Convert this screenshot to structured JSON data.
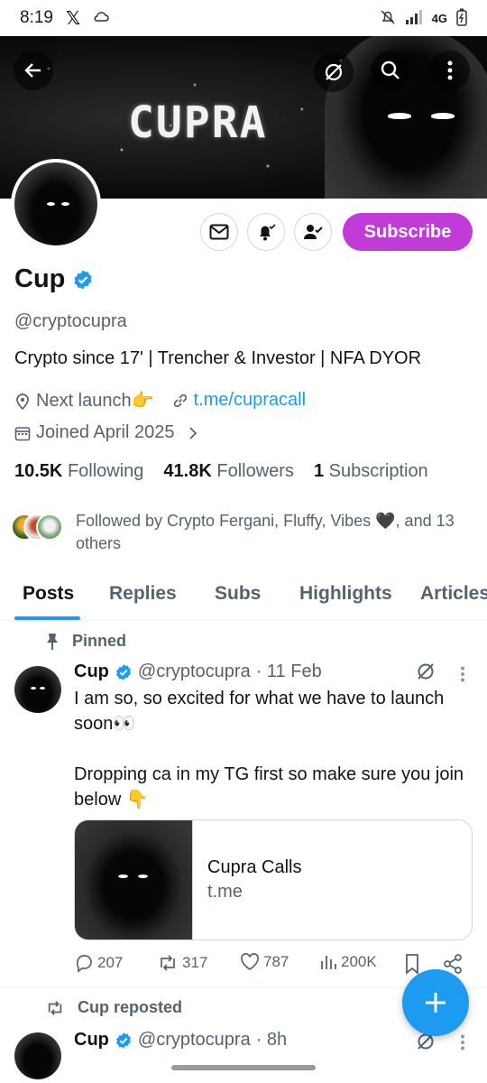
{
  "status_bar": {
    "time": "8:19",
    "network": "4G"
  },
  "banner": {
    "title": "CUPRA"
  },
  "profile": {
    "name": "Cup",
    "handle": "@cryptocupra",
    "bio": "Crypto since 17' | Trencher & Investor | NFA DYOR",
    "location": "Next launch👉",
    "link": "t.me/cupracall",
    "joined": "Joined April 2025",
    "subscribe_label": "Subscribe",
    "stats": {
      "following_count": "10.5K",
      "following_label": "Following",
      "followers_count": "41.8K",
      "followers_label": "Followers",
      "subscriptions_count": "1",
      "subscriptions_label": "Subscription"
    },
    "followed_by": "Followed by Crypto Fergani, Fluffy, Vibes 🖤, and 13 others"
  },
  "tabs": [
    "Posts",
    "Replies",
    "Subs",
    "Highlights",
    "Articles"
  ],
  "pinned_label": "Pinned",
  "posts": [
    {
      "name": "Cup",
      "handle": "@cryptocupra",
      "time": "· 11 Feb",
      "text": "I am so, so excited for what we have to launch soon👀\n\nDropping ca in my TG first so make sure you join below 👇",
      "card": {
        "title": "Cupra Calls",
        "domain": "t.me"
      },
      "replies": "207",
      "reposts": "317",
      "likes": "787",
      "views": "200K"
    },
    {
      "repost_label": "Cup reposted",
      "name": "Cup",
      "handle": "@cryptocupra",
      "time": "· 8h"
    }
  ],
  "colors": {
    "accent": "#1d9bf0",
    "subscribe": "#c03bd8",
    "muted": "#536471"
  },
  "icons": [
    "back-arrow-icon",
    "grok-icon",
    "search-icon",
    "more-vertical-icon",
    "mail-icon",
    "bell-icon",
    "person-check-icon",
    "verified-badge-icon",
    "location-icon",
    "link-icon",
    "calendar-icon",
    "chevron-right-icon",
    "pin-icon",
    "reply-icon",
    "repost-icon",
    "like-icon",
    "views-icon",
    "bookmark-icon",
    "share-icon",
    "compose-plus-icon"
  ]
}
